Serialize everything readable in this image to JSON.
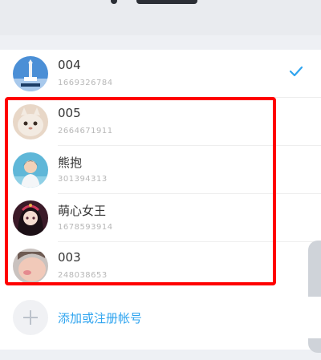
{
  "accounts": [
    {
      "name": "004",
      "number": "1669326784",
      "selected": true,
      "avatar_icon": "rocket-launch-avatar"
    },
    {
      "name": "005",
      "number": "2664671911",
      "selected": false,
      "avatar_icon": "cat-avatar"
    },
    {
      "name": "熊抱",
      "number": "301394313",
      "selected": false,
      "avatar_icon": "boy-avatar"
    },
    {
      "name": "萌心女王",
      "number": "1678593914",
      "selected": false,
      "avatar_icon": "girl-avatar"
    },
    {
      "name": "003",
      "number": "248038653",
      "selected": false,
      "avatar_icon": "face-avatar"
    }
  ],
  "add_account": {
    "label": "添加或注册帐号",
    "icon": "plus-icon"
  },
  "colors": {
    "accent": "#2fa4ef",
    "check": "#2fa4ef",
    "highlight": "#ff0000"
  }
}
